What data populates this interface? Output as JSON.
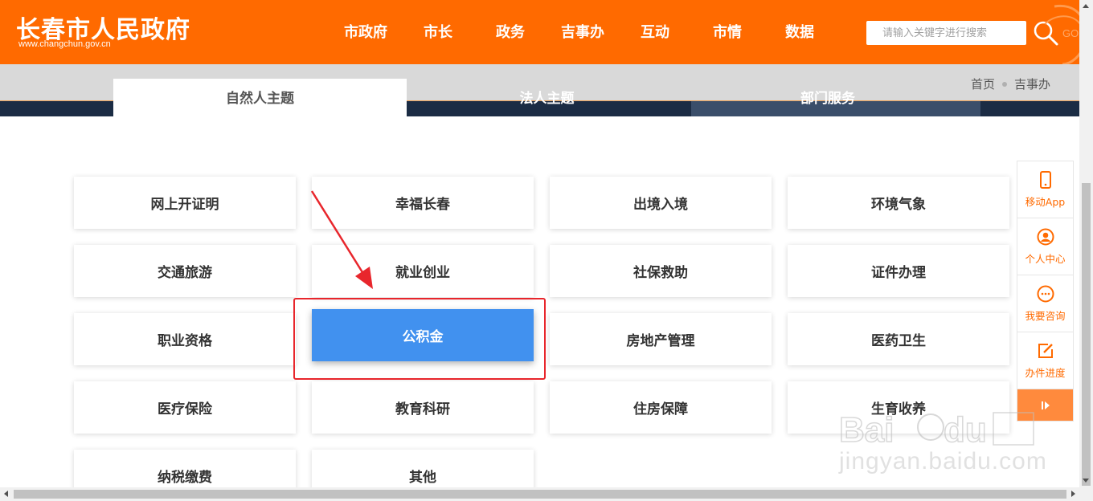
{
  "header": {
    "site_title": "长春市人民政府",
    "site_url": "www.changchun.gov.cn",
    "nav": [
      "市政府",
      "市长",
      "政务",
      "吉事办",
      "互动",
      "市情",
      "数据"
    ],
    "search_placeholder": "请输入关键字进行搜索",
    "gov_mark": "GO"
  },
  "tabs": [
    "自然人主题",
    "法人主题",
    "部门服务"
  ],
  "breadcrumb": [
    "首页",
    "吉事办"
  ],
  "tiles": [
    "网上开证明",
    "幸福长春",
    "出境入境",
    "环境气象",
    "交通旅游",
    "就业创业",
    "社保救助",
    "证件办理",
    "职业资格",
    "公积金",
    "房地产管理",
    "医药卫生",
    "医疗保险",
    "教育科研",
    "住房保障",
    "生育收养",
    "纳税缴费",
    "其他"
  ],
  "active_tile": "公积金",
  "float_bar": [
    {
      "label": "移动App",
      "icon": "mobile-icon"
    },
    {
      "label": "个人中心",
      "icon": "user-icon"
    },
    {
      "label": "我要咨询",
      "icon": "chat-icon"
    },
    {
      "label": "办件进度",
      "icon": "edit-icon"
    }
  ],
  "watermark": {
    "text": "jingyan.baidu.com"
  },
  "colors": {
    "brand": "#ff6a00",
    "active_tile": "#4191ef",
    "highlight": "#e8262c"
  }
}
